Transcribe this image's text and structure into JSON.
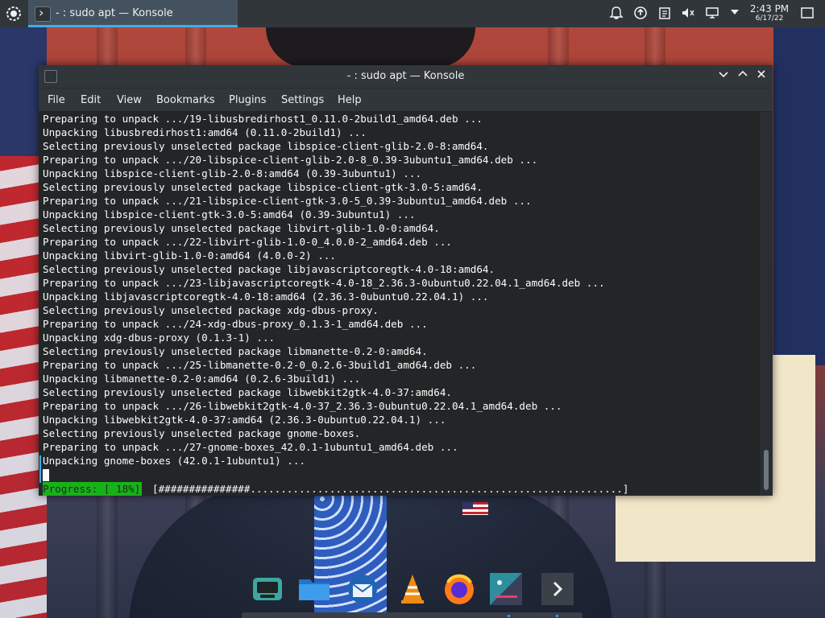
{
  "panel": {
    "task_title": "- : sudo apt — Konsole",
    "clock_time": "2:43 PM",
    "clock_date": "6/17/22",
    "tray_icons": [
      "notifications-icon",
      "updates-icon",
      "clipboard-icon",
      "volume-muted-icon",
      "display-icon",
      "tray-expand-icon",
      "show-desktop-icon"
    ]
  },
  "window": {
    "title": "- : sudo apt — Konsole",
    "menu": [
      "File",
      "Edit",
      "View",
      "Bookmarks",
      "Plugins",
      "Settings",
      "Help"
    ]
  },
  "terminal": {
    "lines": [
      "Preparing to unpack .../19-libusbredirhost1_0.11.0-2build1_amd64.deb ...",
      "Unpacking libusbredirhost1:amd64 (0.11.0-2build1) ...",
      "Selecting previously unselected package libspice-client-glib-2.0-8:amd64.",
      "Preparing to unpack .../20-libspice-client-glib-2.0-8_0.39-3ubuntu1_amd64.deb ...",
      "Unpacking libspice-client-glib-2.0-8:amd64 (0.39-3ubuntu1) ...",
      "Selecting previously unselected package libspice-client-gtk-3.0-5:amd64.",
      "Preparing to unpack .../21-libspice-client-gtk-3.0-5_0.39-3ubuntu1_amd64.deb ...",
      "Unpacking libspice-client-gtk-3.0-5:amd64 (0.39-3ubuntu1) ...",
      "Selecting previously unselected package libvirt-glib-1.0-0:amd64.",
      "Preparing to unpack .../22-libvirt-glib-1.0-0_4.0.0-2_amd64.deb ...",
      "Unpacking libvirt-glib-1.0-0:amd64 (4.0.0-2) ...",
      "Selecting previously unselected package libjavascriptcoregtk-4.0-18:amd64.",
      "Preparing to unpack .../23-libjavascriptcoregtk-4.0-18_2.36.3-0ubuntu0.22.04.1_amd64.deb ...",
      "Unpacking libjavascriptcoregtk-4.0-18:amd64 (2.36.3-0ubuntu0.22.04.1) ...",
      "Selecting previously unselected package xdg-dbus-proxy.",
      "Preparing to unpack .../24-xdg-dbus-proxy_0.1.3-1_amd64.deb ...",
      "Unpacking xdg-dbus-proxy (0.1.3-1) ...",
      "Selecting previously unselected package libmanette-0.2-0:amd64.",
      "Preparing to unpack .../25-libmanette-0.2-0_0.2.6-3build1_amd64.deb ...",
      "Unpacking libmanette-0.2-0:amd64 (0.2.6-3build1) ...",
      "Selecting previously unselected package libwebkit2gtk-4.0-37:amd64.",
      "Preparing to unpack .../26-libwebkit2gtk-4.0-37_2.36.3-0ubuntu0.22.04.1_amd64.deb ...",
      "Unpacking libwebkit2gtk-4.0-37:amd64 (2.36.3-0ubuntu0.22.04.1) ...",
      "Selecting previously unselected package gnome-boxes.",
      "Preparing to unpack .../27-gnome-boxes_42.0.1-1ubuntu1_amd64.deb ...",
      "Unpacking gnome-boxes (42.0.1-1ubuntu1) ..."
    ],
    "progress_label": "Progress: [ 18%]",
    "progress_bar": "[###############.............................................................]",
    "progress_fraction": 0.18
  },
  "dock": {
    "items": [
      "boxes-icon",
      "file-manager-icon",
      "mail-icon",
      "vlc-icon",
      "firefox-icon",
      "kdenlive-icon",
      "terminal-icon"
    ]
  },
  "colors": {
    "accent": "#3daee9",
    "progress_green": "#18b218",
    "terminal_bg": "#232627",
    "panel_bg": "#31363b"
  }
}
